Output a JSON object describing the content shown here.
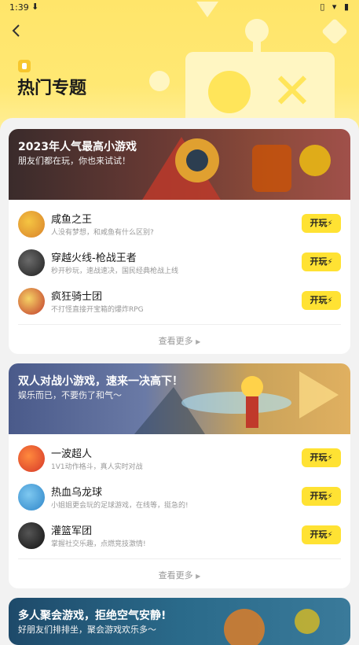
{
  "status": {
    "time": "1:39",
    "download": "⬇",
    "right_icons": "▯ ▾ ▮"
  },
  "header": {
    "title": "热门专题"
  },
  "colors": {
    "accent": "#ffe233",
    "header_bg": "#ffe56a"
  },
  "sections": [
    {
      "title": "2023年人气最高小游戏",
      "subtitle": "朋友们都在玩，你也来试试！",
      "games": [
        {
          "name": "咸鱼之王",
          "desc": "人没有梦想，和咸鱼有什么区别?",
          "button": "开玩"
        },
        {
          "name": "穿越火线-枪战王者",
          "desc": "秒开秒玩，速战速决，国民经典枪战上线",
          "button": "开玩"
        },
        {
          "name": "疯狂骑士团",
          "desc": "不打怪直接开宝箱的爆炸RPG",
          "button": "开玩"
        }
      ],
      "more": "查看更多"
    },
    {
      "title": "双人对战小游戏，速来一决高下！",
      "subtitle": "娱乐而已，不要伤了和气～",
      "games": [
        {
          "name": "一波超人",
          "desc": "1V1动作格斗，真人实时对战",
          "button": "开玩"
        },
        {
          "name": "热血乌龙球",
          "desc": "小姐姐更会玩的足球游戏，在线等，挺急的!",
          "button": "开玩"
        },
        {
          "name": "灌篮军团",
          "desc": "掌握社交乐趣，点燃竞技激情!",
          "button": "开玩"
        }
      ],
      "more": "查看更多"
    },
    {
      "title": "多人聚会游戏，拒绝空气安静!",
      "subtitle": "好朋友们排排坐，聚会游戏欢乐多～"
    }
  ]
}
